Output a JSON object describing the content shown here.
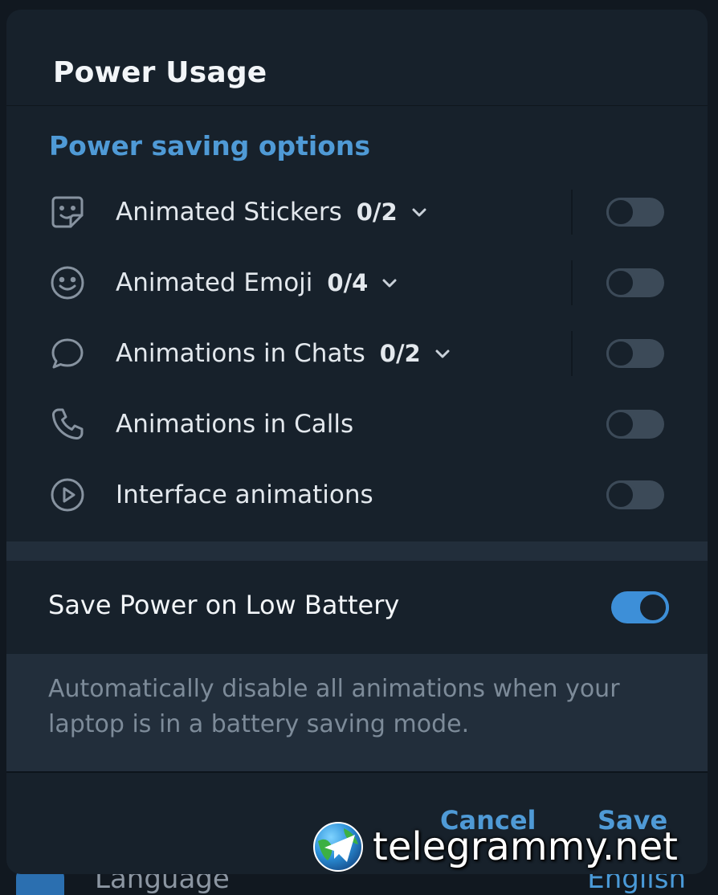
{
  "background": {
    "row_label": "Language",
    "row_value": "English"
  },
  "dialog": {
    "title": "Power Usage",
    "section_header": "Power saving options",
    "options": [
      {
        "label": "Animated Stickers",
        "count": "0/2",
        "icon": "sticker-icon",
        "expandable": true,
        "enabled": false
      },
      {
        "label": "Animated Emoji",
        "count": "0/4",
        "icon": "smile-icon",
        "expandable": true,
        "enabled": false
      },
      {
        "label": "Animations in Chats",
        "count": "0/2",
        "icon": "chat-bubble-icon",
        "expandable": true,
        "enabled": false
      },
      {
        "label": "Animations in Calls",
        "icon": "phone-icon",
        "expandable": false,
        "enabled": false
      },
      {
        "label": "Interface animations",
        "icon": "play-circle-icon",
        "expandable": false,
        "enabled": false
      }
    ],
    "low_battery": {
      "label": "Save Power on Low Battery",
      "enabled": true,
      "hint": "Automatically disable all animations when your laptop is in a battery saving mode."
    },
    "buttons": {
      "cancel": "Cancel",
      "save": "Save"
    }
  },
  "watermark": {
    "text": "telegrammy.net"
  },
  "colors": {
    "accent": "#4f9ad6",
    "dialog_bg": "#17212b",
    "toggle_off": "#3c4a58",
    "toggle_on": "#3d8fd8"
  }
}
